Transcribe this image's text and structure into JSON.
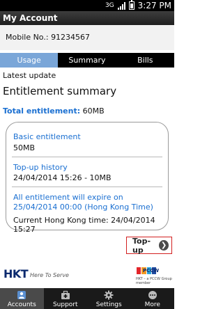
{
  "status_bar": {
    "time": "3:27 PM",
    "network": "3G"
  },
  "app_title": "My Account",
  "mobile": {
    "label": "Mobile No.:",
    "number": "91234567"
  },
  "tabs": [
    {
      "label": "Usage",
      "active": true
    },
    {
      "label": "Summary",
      "active": false
    },
    {
      "label": "Bills",
      "active": false
    }
  ],
  "latest_update_label": "Latest update",
  "entitlement_title": "Entitlement summary",
  "total": {
    "label": "Total entitlement:",
    "value": "60MB"
  },
  "card": {
    "basic_label": "Basic entitlement",
    "basic_value": "50MB",
    "topup_label": "Top-up history",
    "topup_value": "24/04/2014 15:26 - 10MB",
    "expiry_notice": "All entitlement will expire on 25/04/2014 00:00 (Hong Kong Time)",
    "current_time": "Current Hong Kong time: 24/04/2014 15:27"
  },
  "topup_button": {
    "label": "Top-up",
    "icon": "chevron-right-icon"
  },
  "footer": {
    "hkt_logo": "HKT",
    "hkt_tagline": "Here To Serve",
    "pccw_logo": "PCCW",
    "pccw_sub": "HKT – a PCCW Group member"
  },
  "bottom_nav": [
    {
      "label": "Accounts",
      "icon": "person-icon",
      "active": true
    },
    {
      "label": "Support",
      "icon": "toolbox-icon",
      "active": false
    },
    {
      "label": "Settings",
      "icon": "gear-icon",
      "active": false
    },
    {
      "label": "More",
      "icon": "more-icon",
      "active": false
    }
  ],
  "colors": {
    "accent_blue": "#1a6fd1",
    "tab_active": "#7aa6d8",
    "topup_border": "#d21f1f"
  }
}
